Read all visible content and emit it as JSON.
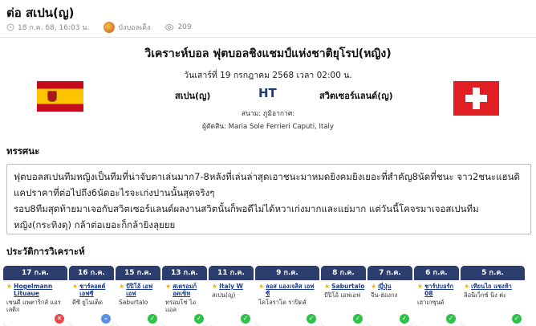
{
  "page": {
    "title": "ต่อ สเปน(ญ)"
  },
  "meta": {
    "date": "18 ก.ค. 68, 16:03 น.",
    "author": "บังบอลเด็ง",
    "views": "209"
  },
  "article": {
    "heading": "วิเคราะห์บอล ฟุตบอลชิงแชมป์แห่งชาติยุโรป(หญิง)",
    "date": "วันเสาร์ที่ 19 กรกฎาคม 2568 เวลา 02:00 น.",
    "home_team": "สเปน(ญ)",
    "status": "HT",
    "away_team": "สวิตเซอร์แลนด์(ญ)",
    "stadium": "สนาม: ภูมิอากาศ:",
    "referee": "ผู้ตัดสิน: Maria Sole Ferrieri Caputi, Italy"
  },
  "opinion": {
    "title": "ทรรศนะ",
    "paragraph1": "ฟุตบอลสเปนทีมหญิงเป็นทีมที่น่าจับตาเล่นมาก7-8หลังที่เล่นล่าสุดเอาชนะมาหมดยิงคมยิงเยอะที่สำคัญ8นัดที่ชนะ จาว2ชนะแฮนดิแคปราคาที่ต่อไปถึง6นัดอะไรจะเก่งปานนั้นสุดจริงๆ",
    "paragraph2": "รอบ8ทีมสุดท้ายมาเจอกับสวิตเซอร์แลนด์ผลงานสวิตนั้นก็พอดีไม่ได้หวาเก่งมากและแย่มาก แต่วันนี้โคจรมาเจอสเปนทีมหญิง(กระทิงดุ) กล้าต่อเยอะก็กล้ายิงลุยยย"
  },
  "history": {
    "title": "ประวัติการวิเคราะห์",
    "cards": [
      {
        "date": "17 ก.ค.",
        "team": "Hogelmann Lituaue",
        "result_text": "เชนดี แพตาริกส์ แอรเลติก",
        "result": "L"
      },
      {
        "date": "16 ก.ค.",
        "team": "ชาร์ลอตต์ เอฟซี",
        "result_text": "ดีซี ยูไนเต็ด",
        "result": "D"
      },
      {
        "date": "15 ก.ค.",
        "team": "บีปิโอ้ เอฟเอฟ",
        "result_text": "Saburtalo",
        "result": "W"
      },
      {
        "date": "13 ก.ค.",
        "team": "สเตรอมก็อดเซ็ท",
        "result_text": "ทรอมโซ่ ไอแอล",
        "result": "W"
      },
      {
        "date": "11 ก.ค.",
        "team": "Italy W",
        "result_text": "สเปน(ญ)",
        "result": "W"
      },
      {
        "date": "9 ก.ค.",
        "team": "ลอส แองเจลิส เอฟซี",
        "result_text": "โคโลราโด ราปิดส์",
        "result": "W"
      },
      {
        "date": "8 ก.ค.",
        "team": "Saburtalo",
        "result_text": "บีปิโอ้ เอฟเอฟ",
        "result": "W"
      },
      {
        "date": "7 ก.ค.",
        "team": "ญี่ปุ่น",
        "result_text": "จีน-ฮ่องกง",
        "result": "W"
      },
      {
        "date": "6 ก.ค.",
        "team": "ชาร์ปบอร์ก 08",
        "result_text": "เฮาเกซุนด์",
        "result": "W"
      },
      {
        "date": "5 ก.ค.",
        "team": "เทียนไถ แชงห้า",
        "result_text": "ลิอนิเว็กซ์ นิง ต่ะ",
        "result": "W"
      }
    ]
  }
}
